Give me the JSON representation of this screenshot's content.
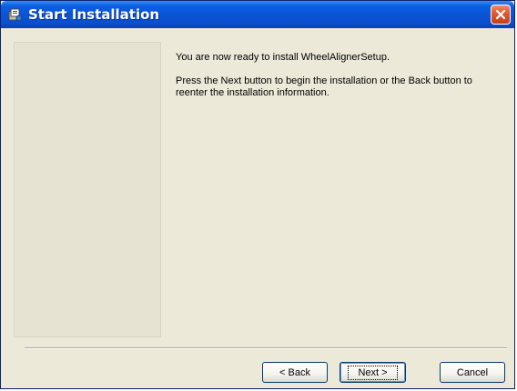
{
  "window": {
    "title": "Start Installation",
    "icon": "installer-icon",
    "close_icon": "close-icon"
  },
  "content": {
    "ready_message": "You are now ready to install  WheelAlignerSetup.",
    "instruction": "Press the Next button to begin the installation or the Back button to reenter the installation information."
  },
  "buttons": {
    "back": "< Back",
    "next": "Next >",
    "cancel": "Cancel"
  },
  "colors": {
    "titlebar": "#0a55d6",
    "close": "#e15a30",
    "dialog_bg": "#ece9d8"
  }
}
